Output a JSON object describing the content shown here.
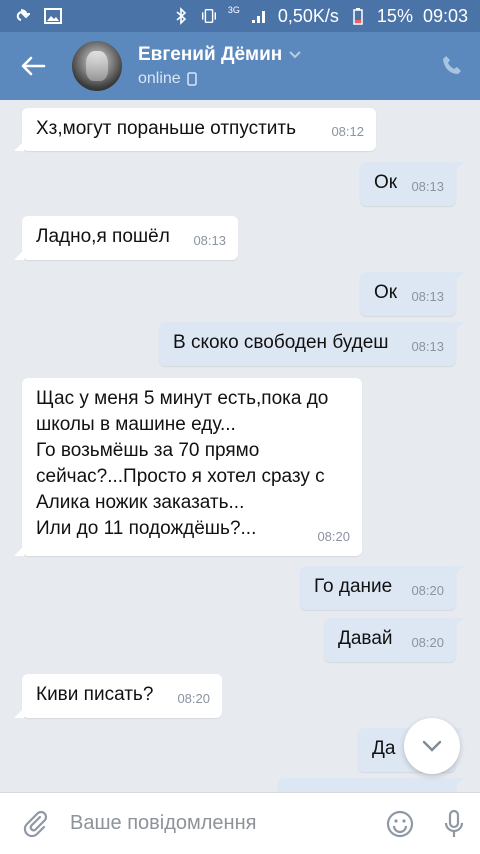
{
  "status_bar": {
    "speed": "0,50K/s",
    "battery": "15%",
    "time": "09:03",
    "network": "3G"
  },
  "header": {
    "name": "Евгений Дёмин",
    "status": "online"
  },
  "messages": [
    {
      "dir": "in",
      "text": "Хз,могут пораньше отпустить",
      "time": "08:12"
    },
    {
      "dir": "out",
      "text": "Ок",
      "time": "08:13"
    },
    {
      "dir": "in",
      "text": "Ладно,я пошёл",
      "time": "08:13"
    },
    {
      "dir": "out",
      "text": "Ок",
      "time": "08:13"
    },
    {
      "dir": "out",
      "text": "В скоко свободен будеш",
      "time": "08:13"
    },
    {
      "dir": "in",
      "text": "Щас у меня 5 минут есть,пока до\nшколы в машине еду...\nГо возьмёшь за 70 прямо\nсейчас?...Просто я хотел сразу с\nАлика ножик заказать...\nИли до 11 подождёшь?...",
      "time": "08:20"
    },
    {
      "dir": "out",
      "text": "Го дание",
      "time": "08:20"
    },
    {
      "dir": "out",
      "text": "Давай",
      "time": "08:20"
    },
    {
      "dir": "in",
      "text": "Киви писать?",
      "time": "08:20"
    },
    {
      "dir": "out",
      "text": "Да",
      "time": ""
    }
  ],
  "input": {
    "placeholder": "Ваше повідомлення"
  },
  "colors": {
    "header": "#5b88bd",
    "status_bar": "#4a74a8",
    "incoming": "#ffffff",
    "outgoing": "#dde7f3",
    "background": "#e7ebf0"
  }
}
